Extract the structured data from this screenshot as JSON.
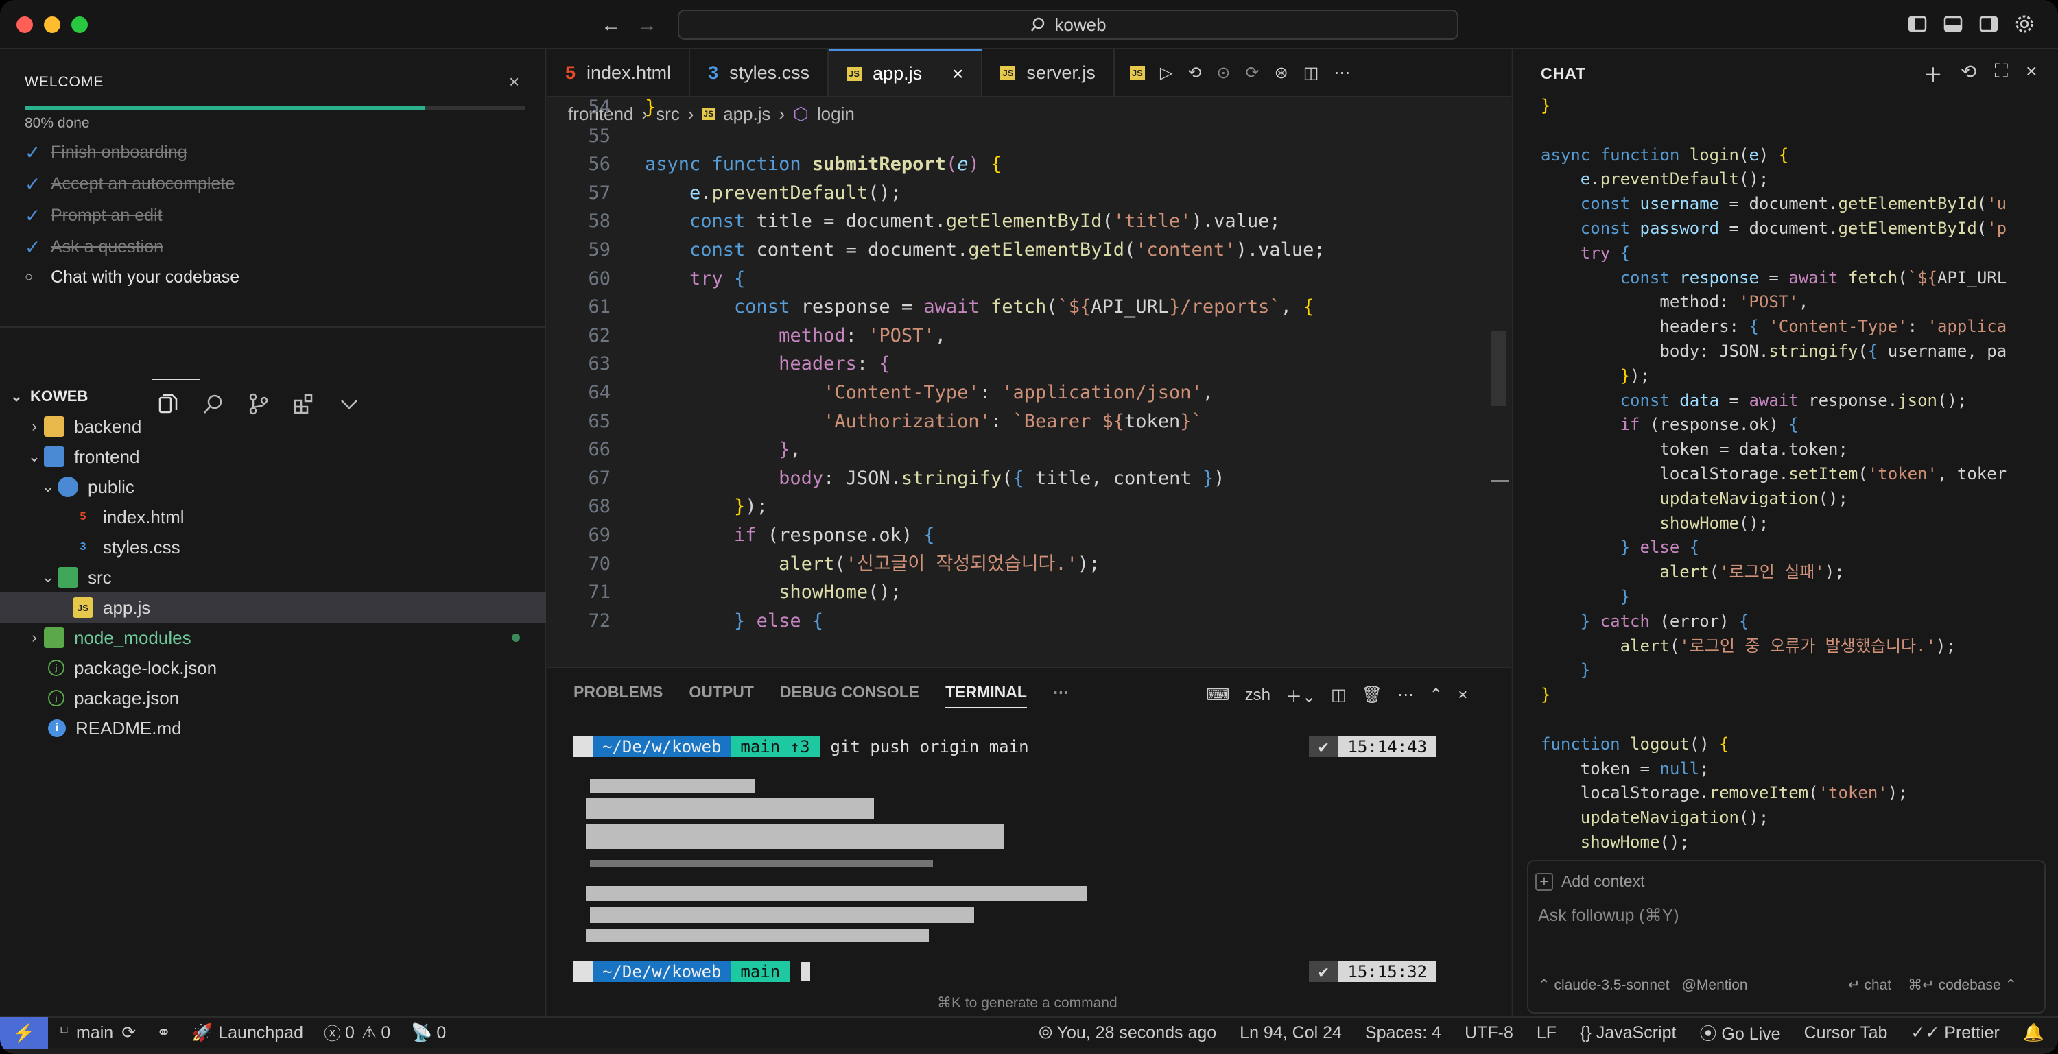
{
  "titlebar": {
    "search_text": "koweb"
  },
  "welcome": {
    "title": "WELCOME",
    "progress_percent": 80,
    "progress_text": "80% done",
    "items": [
      {
        "label": "Finish onboarding",
        "done": true
      },
      {
        "label": "Accept an autocomplete",
        "done": true
      },
      {
        "label": "Prompt an edit",
        "done": true
      },
      {
        "label": "Ask a question",
        "done": true
      },
      {
        "label": "Chat with your codebase",
        "done": false
      }
    ]
  },
  "explorer": {
    "root": "KOWEB",
    "items": [
      {
        "label": "backend",
        "type": "folder",
        "depth": 0
      },
      {
        "label": "frontend",
        "type": "folder-open",
        "depth": 0
      },
      {
        "label": "public",
        "type": "folder-open",
        "depth": 1
      },
      {
        "label": "index.html",
        "type": "html",
        "depth": 2
      },
      {
        "label": "styles.css",
        "type": "css",
        "depth": 2
      },
      {
        "label": "src",
        "type": "folder-open",
        "depth": 1
      },
      {
        "label": "app.js",
        "type": "js",
        "depth": 2
      },
      {
        "label": "node_modules",
        "type": "folder",
        "depth": 0
      },
      {
        "label": "package-lock.json",
        "type": "json",
        "depth": 0
      },
      {
        "label": "package.json",
        "type": "json",
        "depth": 0
      },
      {
        "label": "README.md",
        "type": "info",
        "depth": 0
      }
    ]
  },
  "tabs": [
    {
      "label": "index.html",
      "icon": "html5-icon"
    },
    {
      "label": "styles.css",
      "icon": "css3-icon"
    },
    {
      "label": "app.js",
      "icon": "js-icon",
      "active": true
    },
    {
      "label": "server.js",
      "icon": "js-icon"
    }
  ],
  "breadcrumb": [
    "frontend",
    "src",
    "app.js",
    "login"
  ],
  "code": {
    "line_numbers": [
      "54",
      "55",
      "56",
      "57",
      "58",
      "59",
      "60",
      "61",
      "62",
      "63",
      "64",
      "65",
      "66",
      "67",
      "68",
      "69",
      "70",
      "71",
      "72"
    ]
  },
  "panel": {
    "tabs": [
      "PROBLEMS",
      "OUTPUT",
      "DEBUG CONSOLE",
      "TERMINAL"
    ],
    "shell": "zsh",
    "prompt_path": "~/De/w/koweb",
    "branch1": "main ↑3",
    "branch2": "main",
    "command": "git push origin main",
    "time1": "15:14:43",
    "time2": "15:15:32",
    "hint": "⌘K to generate a command"
  },
  "chat": {
    "title": "CHAT",
    "add_context": "Add context",
    "placeholder": "Ask followup (⌘Y)",
    "model": "claude-3.5-sonnet",
    "mention": "Mention",
    "chat_btn": "chat",
    "codebase_btn": "codebase"
  },
  "status": {
    "branch": "main",
    "launchpad": "Launchpad",
    "errors": "0",
    "warnings": "0",
    "ports": "0",
    "blame": "You, 28 seconds ago",
    "position": "Ln 94, Col 24",
    "spaces": "Spaces: 4",
    "encoding": "UTF-8",
    "eol": "LF",
    "language": "JavaScript",
    "golive": "Go Live",
    "cursortab": "Cursor Tab",
    "prettier": "Prettier"
  },
  "colors": {
    "accent": "#4a90e2",
    "progress": "#2ab28c",
    "remote": "#4a6cd4"
  }
}
